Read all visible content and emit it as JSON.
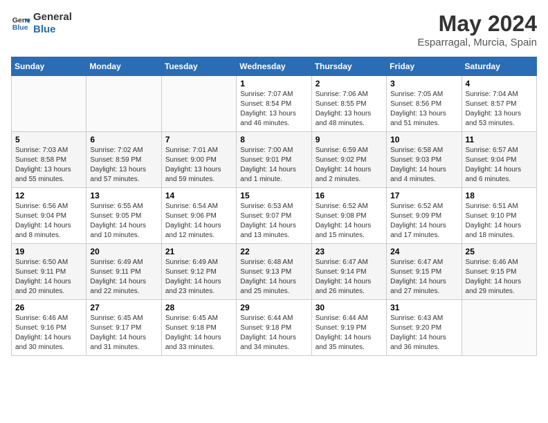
{
  "logo": {
    "line1": "General",
    "line2": "Blue"
  },
  "title": "May 2024",
  "subtitle": "Esparragal, Murcia, Spain",
  "header": {
    "days": [
      "Sunday",
      "Monday",
      "Tuesday",
      "Wednesday",
      "Thursday",
      "Friday",
      "Saturday"
    ]
  },
  "weeks": [
    {
      "cells": [
        {
          "day": "",
          "info": ""
        },
        {
          "day": "",
          "info": ""
        },
        {
          "day": "",
          "info": ""
        },
        {
          "day": "1",
          "info": "Sunrise: 7:07 AM\nSunset: 8:54 PM\nDaylight: 13 hours\nand 46 minutes."
        },
        {
          "day": "2",
          "info": "Sunrise: 7:06 AM\nSunset: 8:55 PM\nDaylight: 13 hours\nand 48 minutes."
        },
        {
          "day": "3",
          "info": "Sunrise: 7:05 AM\nSunset: 8:56 PM\nDaylight: 13 hours\nand 51 minutes."
        },
        {
          "day": "4",
          "info": "Sunrise: 7:04 AM\nSunset: 8:57 PM\nDaylight: 13 hours\nand 53 minutes."
        }
      ]
    },
    {
      "cells": [
        {
          "day": "5",
          "info": "Sunrise: 7:03 AM\nSunset: 8:58 PM\nDaylight: 13 hours\nand 55 minutes."
        },
        {
          "day": "6",
          "info": "Sunrise: 7:02 AM\nSunset: 8:59 PM\nDaylight: 13 hours\nand 57 minutes."
        },
        {
          "day": "7",
          "info": "Sunrise: 7:01 AM\nSunset: 9:00 PM\nDaylight: 13 hours\nand 59 minutes."
        },
        {
          "day": "8",
          "info": "Sunrise: 7:00 AM\nSunset: 9:01 PM\nDaylight: 14 hours\nand 1 minute."
        },
        {
          "day": "9",
          "info": "Sunrise: 6:59 AM\nSunset: 9:02 PM\nDaylight: 14 hours\nand 2 minutes."
        },
        {
          "day": "10",
          "info": "Sunrise: 6:58 AM\nSunset: 9:03 PM\nDaylight: 14 hours\nand 4 minutes."
        },
        {
          "day": "11",
          "info": "Sunrise: 6:57 AM\nSunset: 9:04 PM\nDaylight: 14 hours\nand 6 minutes."
        }
      ]
    },
    {
      "cells": [
        {
          "day": "12",
          "info": "Sunrise: 6:56 AM\nSunset: 9:04 PM\nDaylight: 14 hours\nand 8 minutes."
        },
        {
          "day": "13",
          "info": "Sunrise: 6:55 AM\nSunset: 9:05 PM\nDaylight: 14 hours\nand 10 minutes."
        },
        {
          "day": "14",
          "info": "Sunrise: 6:54 AM\nSunset: 9:06 PM\nDaylight: 14 hours\nand 12 minutes."
        },
        {
          "day": "15",
          "info": "Sunrise: 6:53 AM\nSunset: 9:07 PM\nDaylight: 14 hours\nand 13 minutes."
        },
        {
          "day": "16",
          "info": "Sunrise: 6:52 AM\nSunset: 9:08 PM\nDaylight: 14 hours\nand 15 minutes."
        },
        {
          "day": "17",
          "info": "Sunrise: 6:52 AM\nSunset: 9:09 PM\nDaylight: 14 hours\nand 17 minutes."
        },
        {
          "day": "18",
          "info": "Sunrise: 6:51 AM\nSunset: 9:10 PM\nDaylight: 14 hours\nand 18 minutes."
        }
      ]
    },
    {
      "cells": [
        {
          "day": "19",
          "info": "Sunrise: 6:50 AM\nSunset: 9:11 PM\nDaylight: 14 hours\nand 20 minutes."
        },
        {
          "day": "20",
          "info": "Sunrise: 6:49 AM\nSunset: 9:11 PM\nDaylight: 14 hours\nand 22 minutes."
        },
        {
          "day": "21",
          "info": "Sunrise: 6:49 AM\nSunset: 9:12 PM\nDaylight: 14 hours\nand 23 minutes."
        },
        {
          "day": "22",
          "info": "Sunrise: 6:48 AM\nSunset: 9:13 PM\nDaylight: 14 hours\nand 25 minutes."
        },
        {
          "day": "23",
          "info": "Sunrise: 6:47 AM\nSunset: 9:14 PM\nDaylight: 14 hours\nand 26 minutes."
        },
        {
          "day": "24",
          "info": "Sunrise: 6:47 AM\nSunset: 9:15 PM\nDaylight: 14 hours\nand 27 minutes."
        },
        {
          "day": "25",
          "info": "Sunrise: 6:46 AM\nSunset: 9:15 PM\nDaylight: 14 hours\nand 29 minutes."
        }
      ]
    },
    {
      "cells": [
        {
          "day": "26",
          "info": "Sunrise: 6:46 AM\nSunset: 9:16 PM\nDaylight: 14 hours\nand 30 minutes."
        },
        {
          "day": "27",
          "info": "Sunrise: 6:45 AM\nSunset: 9:17 PM\nDaylight: 14 hours\nand 31 minutes."
        },
        {
          "day": "28",
          "info": "Sunrise: 6:45 AM\nSunset: 9:18 PM\nDaylight: 14 hours\nand 33 minutes."
        },
        {
          "day": "29",
          "info": "Sunrise: 6:44 AM\nSunset: 9:18 PM\nDaylight: 14 hours\nand 34 minutes."
        },
        {
          "day": "30",
          "info": "Sunrise: 6:44 AM\nSunset: 9:19 PM\nDaylight: 14 hours\nand 35 minutes."
        },
        {
          "day": "31",
          "info": "Sunrise: 6:43 AM\nSunset: 9:20 PM\nDaylight: 14 hours\nand 36 minutes."
        },
        {
          "day": "",
          "info": ""
        }
      ]
    }
  ]
}
